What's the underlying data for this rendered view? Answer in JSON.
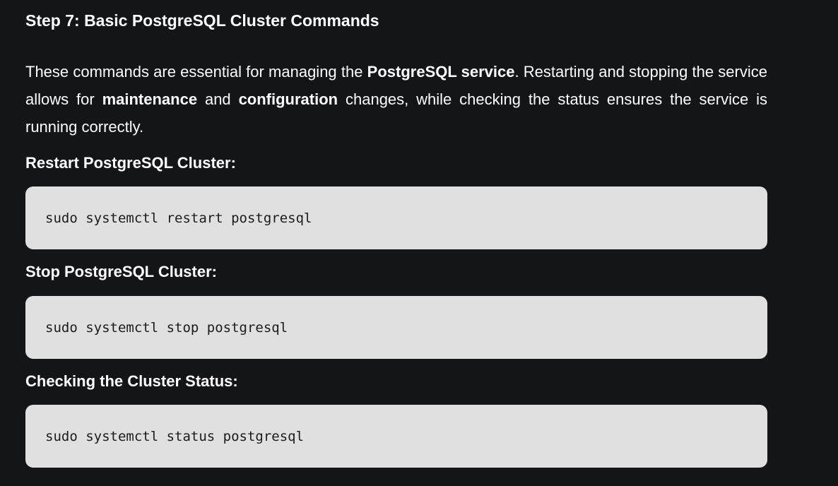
{
  "article": {
    "step_title": "Step 7: Basic PostgreSQL Cluster Commands",
    "intro": {
      "p1": "These commands are essential for managing the ",
      "b1": "PostgreSQL service",
      "p2": ". Restarting and stopping the service allows for ",
      "b2": "maintenance",
      "p3": " and ",
      "b3": "configuration",
      "p4": " changes, while checking the status ensures the service is running correctly."
    },
    "sections": [
      {
        "heading": "Restart PostgreSQL Cluster:",
        "code": "sudo systemctl restart postgresql"
      },
      {
        "heading": "Stop PostgreSQL Cluster:",
        "code": "sudo systemctl stop postgresql"
      },
      {
        "heading": "Checking the Cluster Status:",
        "code": "sudo systemctl status postgresql"
      }
    ]
  }
}
